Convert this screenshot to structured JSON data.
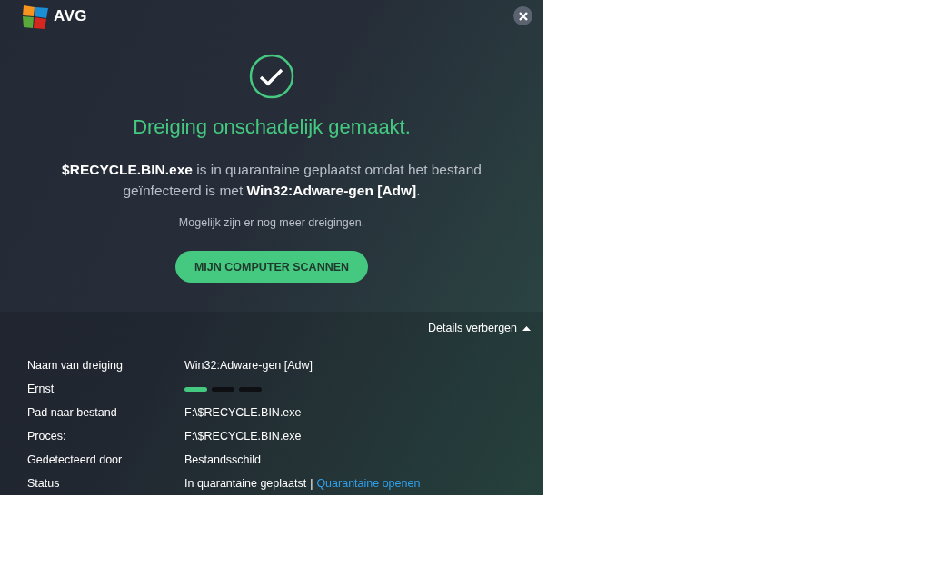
{
  "header": {
    "logo_text": "AVG"
  },
  "result": {
    "title": "Dreiging onschadelijk gemaakt.",
    "message": "**$RECYCLE.BIN.exe** is in quarantaine geplaatst omdat het bestand geïnfecteerd is met **Win32:Adware-gen [Adw]**.",
    "note": "Mogelijk zijn er nog meer dreigingen.",
    "button": "MIJN COMPUTER SCANNEN"
  },
  "details": {
    "toggle": "Details verbergen",
    "expanded": true,
    "rows": [
      {
        "kind": "text",
        "label": "Naam van dreiging",
        "value": "Win32:Adware-gen [Adw]"
      },
      {
        "kind": "severity",
        "label": "Ernst",
        "level": 0.33
      },
      {
        "kind": "text",
        "label": "Pad naar bestand",
        "value": "F:\\$RECYCLE.BIN.exe"
      },
      {
        "kind": "text",
        "label": "Proces:",
        "value": "F:\\$RECYCLE.BIN.exe"
      },
      {
        "kind": "text",
        "label": "Gedetecteerd door",
        "value": "Bestandsschild"
      },
      {
        "kind": "status",
        "label": "Status",
        "value": "In quarantaine geplaatst",
        "separator": "|",
        "link": "Quarantaine openen"
      }
    ]
  }
}
